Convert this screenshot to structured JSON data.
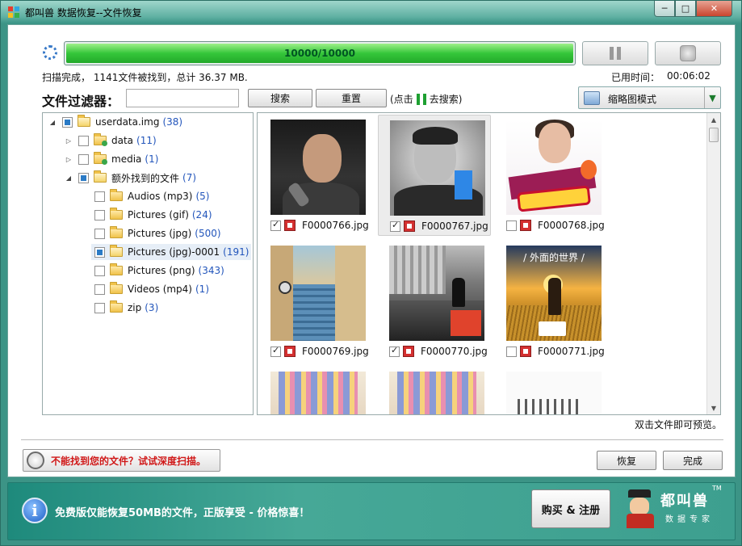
{
  "window": {
    "title": "都叫兽 数据恢复--文件恢复",
    "minimize_glyph": "─",
    "maximize_glyph": "□",
    "close_glyph": "✕"
  },
  "scan": {
    "progress_text": "10000/10000",
    "progress_percent": 100,
    "status": "扫描完成， 1141文件被找到，总计 36.37 MB.",
    "elapsed_label": "已用时间：",
    "elapsed_value": "00:06:02"
  },
  "filter": {
    "label": "文件过滤器：",
    "input_value": "",
    "search_label": "搜索",
    "reset_label": "重置",
    "hint_prefix": "(点击",
    "hint_suffix": "去搜索)"
  },
  "view_mode": {
    "selected": "缩略图模式",
    "arrow_glyph": "▼"
  },
  "tree": {
    "expander_open": "◢",
    "expander_closed": "▷",
    "items": [
      {
        "label": "userdata.img",
        "count": "(38)"
      },
      {
        "label": "data",
        "count": "(11)"
      },
      {
        "label": "media",
        "count": "(1)"
      },
      {
        "label": "额外找到的文件",
        "count": "(7)"
      },
      {
        "label": "Audios (mp3)",
        "count": "(5)"
      },
      {
        "label": "Pictures (gif)",
        "count": "(24)"
      },
      {
        "label": "Pictures (jpg)",
        "count": "(500)"
      },
      {
        "label": "Pictures (jpg)-0001",
        "count": "(191)"
      },
      {
        "label": "Pictures (png)",
        "count": "(343)"
      },
      {
        "label": "Videos (mp4)",
        "count": "(1)"
      },
      {
        "label": "zip",
        "count": "(3)"
      }
    ]
  },
  "files": [
    {
      "name": "F0000766.jpg",
      "checked": true
    },
    {
      "name": "F0000767.jpg",
      "checked": true
    },
    {
      "name": "F0000768.jpg",
      "checked": false
    },
    {
      "name": "F0000769.jpg",
      "checked": true
    },
    {
      "name": "F0000770.jpg",
      "checked": true
    },
    {
      "name": "F0000771.jpg",
      "checked": false
    }
  ],
  "thumb_texts": {
    "t6_caption": "/ 外面的世界 /"
  },
  "scroll": {
    "up_glyph": "▲",
    "down_glyph": "▼"
  },
  "preview_hint": "双击文件即可预览。",
  "deep_scan_label": "不能找到您的文件？试试深度扫描。",
  "recover_label": "恢复",
  "done_label": "完成",
  "footer": {
    "info_glyph": "i",
    "promo": "免费版仅能恢复50MB的文件，正版享受 - 价格惊喜！",
    "buy_label": "购买 & 注册",
    "logo_text": "都叫兽",
    "logo_sub": "数据专家",
    "logo_tm": "TM"
  },
  "colors": {
    "accent_teal": "#3c9486",
    "progress_green": "#35c63a",
    "count_blue": "#2255bb",
    "deep_scan_red": "#d01818"
  }
}
